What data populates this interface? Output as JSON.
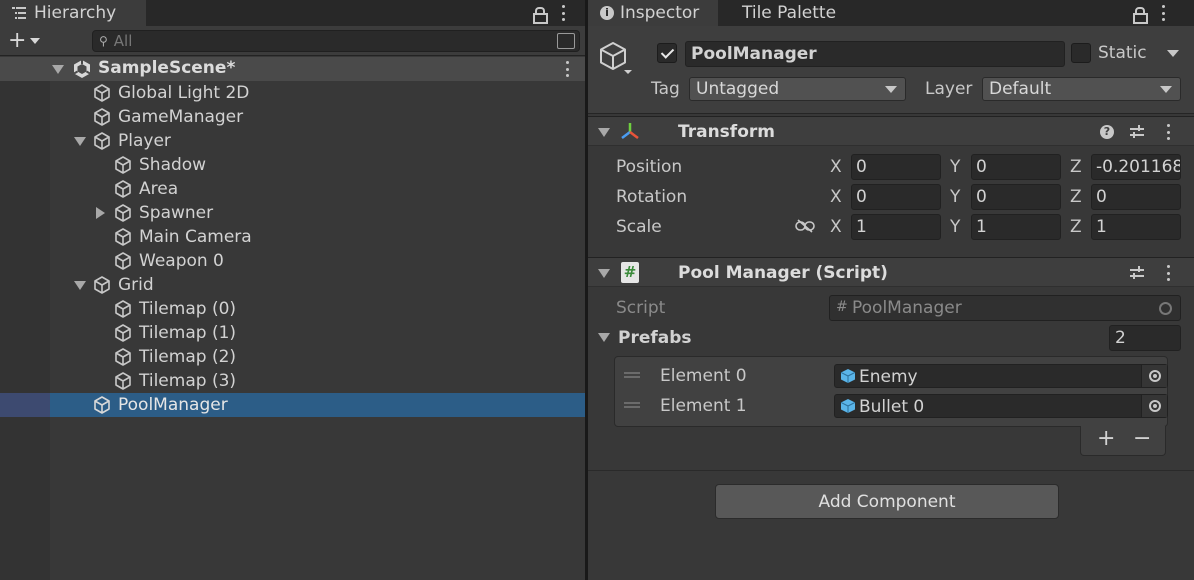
{
  "hierarchy": {
    "tab_label": "Hierarchy",
    "search_placeholder": "All",
    "scene_name": "SampleScene*",
    "items": [
      {
        "label": "Global Light 2D"
      },
      {
        "label": "GameManager"
      },
      {
        "label": "Player"
      },
      {
        "label": "Shadow"
      },
      {
        "label": "Area"
      },
      {
        "label": "Spawner"
      },
      {
        "label": "Main Camera"
      },
      {
        "label": "Weapon 0"
      },
      {
        "label": "Grid"
      },
      {
        "label": "Tilemap (0)"
      },
      {
        "label": "Tilemap (1)"
      },
      {
        "label": "Tilemap (2)"
      },
      {
        "label": "Tilemap (3)"
      },
      {
        "label": "PoolManager"
      }
    ]
  },
  "inspector": {
    "tabs": [
      "Inspector",
      "Tile Palette"
    ],
    "object_name": "PoolManager",
    "static_label": "Static",
    "tag_label": "Tag",
    "tag_value": "Untagged",
    "layer_label": "Layer",
    "layer_value": "Default",
    "transform": {
      "title": "Transform",
      "rows": [
        {
          "label": "Position",
          "x": "0",
          "y": "0",
          "z": "-0.201168"
        },
        {
          "label": "Rotation",
          "x": "0",
          "y": "0",
          "z": "0"
        },
        {
          "label": "Scale",
          "x": "1",
          "y": "1",
          "z": "1"
        }
      ],
      "axes": [
        "X",
        "Y",
        "Z"
      ]
    },
    "script_component": {
      "title": "Pool Manager (Script)",
      "script_label": "Script",
      "script_value": "PoolManager",
      "list_label": "Prefabs",
      "list_count": "2",
      "elements": [
        {
          "label": "Element 0",
          "value": "Enemy"
        },
        {
          "label": "Element 1",
          "value": "Bullet 0"
        }
      ],
      "add_symbol": "+",
      "remove_symbol": "−"
    },
    "add_component_label": "Add Component"
  },
  "colors": {
    "selection": "#2c5d87",
    "panel": "#383838",
    "header": "#3e3e3e"
  }
}
